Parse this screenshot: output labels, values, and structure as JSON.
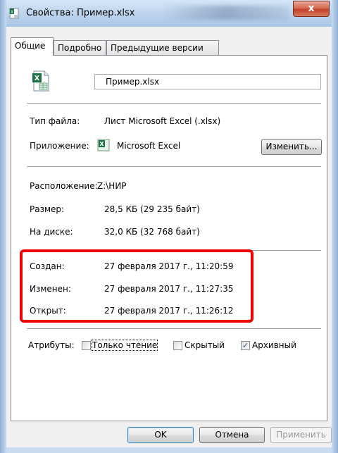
{
  "window": {
    "title": "Свойства: Пример.xlsx",
    "close_glyph": "x"
  },
  "tabs": [
    {
      "label": "Общие",
      "active": true
    },
    {
      "label": "Подробно",
      "active": false
    },
    {
      "label": "Предыдущие версии",
      "active": false
    }
  ],
  "file": {
    "name": "Пример.xlsx",
    "icon": "excel-file-icon"
  },
  "info": {
    "type_label": "Тип файла:",
    "type_value": "Лист Microsoft Excel (.xlsx)",
    "app_label": "Приложение:",
    "app_value": "Microsoft Excel",
    "change_button": "Изменить...",
    "location_label": "Расположение:",
    "location_value": "Z:\\НИР",
    "size_label": "Размер:",
    "size_value": "28,5 КБ (29 235 байт)",
    "disk_label": "На диске:",
    "disk_value": "32,0 КБ (32 768 байт)"
  },
  "dates": {
    "created_label": "Создан:",
    "created_value": "27 февраля 2017 г., 11:20:59",
    "modified_label": "Изменен:",
    "modified_value": "27 февраля 2017 г., 11:27:35",
    "opened_label": "Открыт:",
    "opened_value": "27 февраля 2017 г., 11:26:12"
  },
  "attributes": {
    "label": "Атрибуты:",
    "readonly": {
      "label": "Только чтение",
      "checked": false
    },
    "hidden": {
      "label": "Скрытый",
      "checked": false
    },
    "archive": {
      "label": "Архивный",
      "checked": true
    }
  },
  "buttons": {
    "ok": "OK",
    "cancel": "Отмена",
    "apply": "Применить"
  },
  "colors": {
    "highlight": "#ee0000",
    "excel_green": "#1e7145"
  }
}
